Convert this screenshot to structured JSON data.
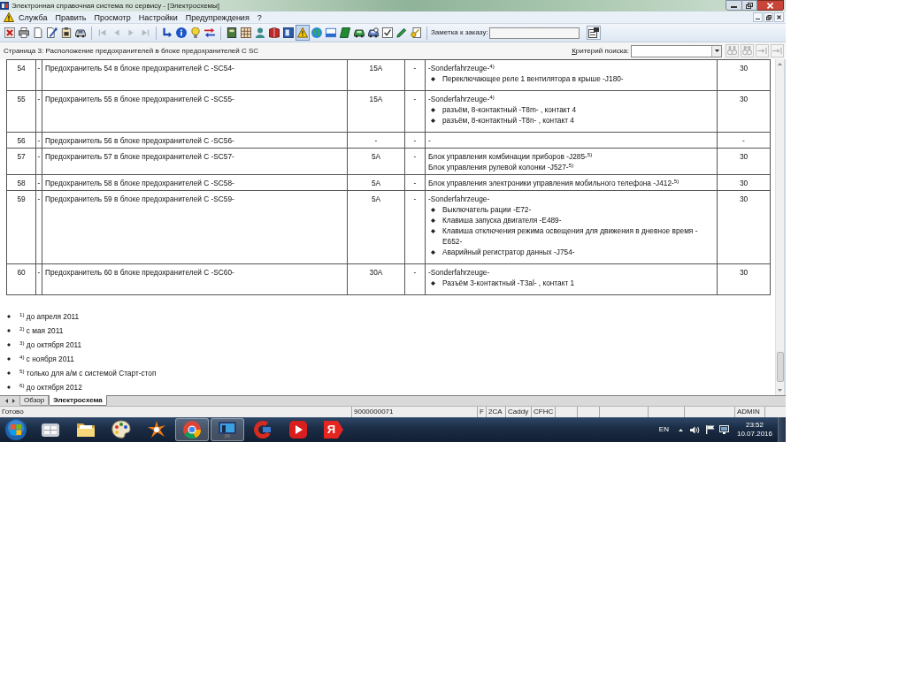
{
  "window": {
    "title": "Электронная справочная система по сервису - [Электросхемы]"
  },
  "menu": [
    "Служба",
    "Править",
    "Просмотр",
    "Настройки",
    "Предупреждения",
    "?"
  ],
  "toolbar": {
    "groups": [
      [
        {
          "kind": "cross",
          "disabled": false,
          "pressed": false
        },
        {
          "kind": "printer",
          "disabled": false,
          "pressed": false
        },
        {
          "kind": "page",
          "disabled": false,
          "pressed": false
        },
        {
          "kind": "wrench",
          "disabled": false,
          "pressed": false
        },
        {
          "kind": "clipboard",
          "disabled": false,
          "pressed": false
        },
        {
          "kind": "car",
          "disabled": false,
          "pressed": false
        }
      ],
      [
        {
          "kind": "first",
          "disabled": true,
          "pressed": false
        },
        {
          "kind": "previous",
          "disabled": true,
          "pressed": false
        },
        {
          "kind": "next",
          "disabled": true,
          "pressed": false
        },
        {
          "kind": "last",
          "disabled": true,
          "pressed": false
        }
      ],
      [
        {
          "kind": "return",
          "disabled": false,
          "pressed": false
        },
        {
          "kind": "info",
          "disabled": false,
          "pressed": false
        },
        {
          "kind": "bulb",
          "disabled": false,
          "pressed": false
        },
        {
          "kind": "swap",
          "disabled": false,
          "pressed": false
        }
      ],
      [
        {
          "kind": "book",
          "disabled": false,
          "pressed": false
        },
        {
          "kind": "grid",
          "disabled": false,
          "pressed": false
        },
        {
          "kind": "person",
          "disabled": false,
          "pressed": false
        },
        {
          "kind": "manual",
          "disabled": false,
          "pressed": false
        },
        {
          "kind": "panel",
          "disabled": false,
          "pressed": false
        },
        {
          "kind": "warning",
          "disabled": false,
          "pressed": true
        },
        {
          "kind": "globe",
          "disabled": false,
          "pressed": false
        },
        {
          "kind": "tray",
          "disabled": false,
          "pressed": false
        },
        {
          "kind": "ledger",
          "disabled": false,
          "pressed": false
        },
        {
          "kind": "vehicle",
          "disabled": false,
          "pressed": false
        },
        {
          "kind": "inspect",
          "disabled": false,
          "pressed": false
        },
        {
          "kind": "checklist",
          "disabled": false,
          "pressed": false
        },
        {
          "kind": "pencil",
          "disabled": false,
          "pressed": false
        },
        {
          "kind": "key",
          "disabled": false,
          "pressed": false
        }
      ]
    ],
    "note_label": "Заметка к заказу:"
  },
  "page": {
    "title": "Страница 3: Расположение предохранителей в блоке предохранителей C SC",
    "search": {
      "label": "Критерий поиска:",
      "buttons": [
        {
          "kind": "find",
          "disabled": true
        },
        {
          "kind": "findall",
          "disabled": true
        },
        {
          "kind": "jump",
          "disabled": true
        },
        {
          "kind": "jump",
          "disabled": true
        }
      ]
    }
  },
  "table": {
    "rows": [
      {
        "column_1": "54",
        "column_2": "-",
        "column_3": "Предохранитель 54 в блоке предохранителей C -SC54-",
        "column_4": "15A",
        "column_5": "-",
        "column_6": [
          {
            "kind": "text",
            "text": "-Sonderfahrzeuge-$^{4)}$"
          },
          {
            "kind": "bullet",
            "text": "Переключающее реле 1 вентилятора в крыше -J180-"
          }
        ],
        "column_7": "30"
      },
      {
        "column_1": "55",
        "column_2": "-",
        "column_3": "Предохранитель 55 в блоке предохранителей C -SC55-",
        "column_4": "15A",
        "column_5": "-",
        "column_6": [
          {
            "kind": "text",
            "text": "-Sonderfahrzeuge-$^{4)}$"
          },
          {
            "kind": "bullet",
            "text": "разъём, 8-контактный -T8m- , контакт 4"
          },
          {
            "kind": "bullet",
            "text": "разъём, 8-контактный -T8n- , контакт 4"
          }
        ],
        "column_7": "30"
      },
      {
        "column_1": "56",
        "column_2": "-",
        "column_3": "Предохранитель 56 в блоке предохранителей C -SC56-",
        "column_4": "-",
        "column_5": "-",
        "column_6": [
          {
            "kind": "text",
            "text": "-"
          }
        ],
        "column_7": "-"
      },
      {
        "column_1": "57",
        "column_2": "-",
        "column_3": "Предохранитель 57 в блоке предохранителей C -SC57-",
        "column_4": "5A",
        "column_5": "-",
        "column_6": [
          {
            "kind": "text",
            "text": "Блок управления комбинации приборов -J285-$^{5)}$"
          },
          {
            "kind": "text",
            "text": "Блок управления рулевой колонки -J527-$^{5)}$"
          }
        ],
        "column_7": "30"
      },
      {
        "column_1": "58",
        "column_2": "-",
        "column_3": "Предохранитель 58 в блоке предохранителей C -SC58-",
        "column_4": "5A",
        "column_5": "-",
        "column_6": [
          {
            "kind": "text",
            "text": "Блок управления электроники управления мобильного телефона -J412-$^{5)}$"
          }
        ],
        "column_7": "30"
      },
      {
        "column_1": "59",
        "column_2": "-",
        "column_3": "Предохранитель 59 в блоке предохранителей C -SC59-",
        "column_4": "5A",
        "column_5": "-",
        "column_6": [
          {
            "kind": "text",
            "text": "-Sonderfahrzeuge-"
          },
          {
            "kind": "bullet",
            "text": "Выключатель рации -E72-"
          },
          {
            "kind": "bullet",
            "text": "Клавиша запуска двигателя -E489-"
          },
          {
            "kind": "bullet",
            "text": "Клавиша отключения режима освещения для движения в дневное время -E652-"
          },
          {
            "kind": "bullet",
            "text": "Аварийный регистратор данных -J754-"
          }
        ],
        "column_7": "30"
      },
      {
        "column_1": "60",
        "column_2": "-",
        "column_3": "Предохранитель 60 в блоке предохранителей C -SC60-",
        "column_4": "30A",
        "column_5": "-",
        "column_6": [
          {
            "kind": "text",
            "text": "-Sonderfahrzeuge-"
          },
          {
            "kind": "bullet",
            "text": "Разъём 3-контактный -T3al- , контакт 1"
          }
        ],
        "column_7": "30"
      }
    ]
  },
  "footnotes": [
    "$^{1)}$ до апреля 2011",
    "$^{2)}$ с мая 2011",
    "$^{3)}$ до октября 2011",
    "$^{4)}$ с ноября 2011",
    "$^{5)}$ только для а/м с системой Старт-стоп",
    "$^{6)}$ до октября 2012"
  ],
  "tabs": [
    {
      "label": "Обзор",
      "selected": false
    },
    {
      "label": "Электросхема",
      "selected": true
    }
  ],
  "status_bar": {
    "text": "Готово",
    "cells": [
      "9000000071",
      "F",
      "2CA",
      "Caddy",
      "CFHC",
      "ADMIN"
    ]
  },
  "taskbar": {
    "apps": [
      {
        "kind": "tiles",
        "running": false
      },
      {
        "kind": "folder",
        "running": false
      },
      {
        "kind": "palette",
        "running": false
      },
      {
        "kind": "splash",
        "running": false
      },
      {
        "kind": "wheel",
        "running": true
      },
      {
        "kind": "monitor",
        "running": true
      },
      {
        "kind": "arc",
        "running": false
      },
      {
        "kind": "player",
        "running": false
      },
      {
        "kind": "tag",
        "running": false,
        "label": "Я"
      }
    ],
    "language": "EN",
    "time": "23:52",
    "date": "10.07.2016"
  }
}
